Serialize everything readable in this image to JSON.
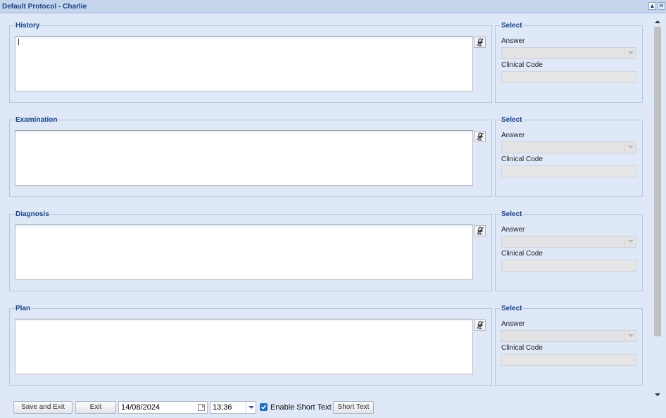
{
  "window": {
    "title": "Default Protocol - Charlie"
  },
  "sections": [
    {
      "name": "History",
      "select_legend": "Select",
      "answer_label": "Answer",
      "code_label": "Clinical Code"
    },
    {
      "name": "Examination",
      "select_legend": "Select",
      "answer_label": "Answer",
      "code_label": "Clinical Code"
    },
    {
      "name": "Diagnosis",
      "select_legend": "Select",
      "answer_label": "Answer",
      "code_label": "Clinical Code"
    },
    {
      "name": "Plan",
      "select_legend": "Select",
      "answer_label": "Answer",
      "code_label": "Clinical Code"
    }
  ],
  "footer": {
    "save_exit_label": "Save and Exit",
    "exit_label": "Exit",
    "date_value": "14/08/2024",
    "time_value": "13:36",
    "enable_short_text_label": "Enable Short Text",
    "enable_short_text_checked": true,
    "short_text_label": "Short Text"
  },
  "icons": {
    "collapse": "collapse-up-icon",
    "close": "close-icon",
    "dictation": "microphone-muted-icon",
    "calendar": "calendar-icon"
  }
}
